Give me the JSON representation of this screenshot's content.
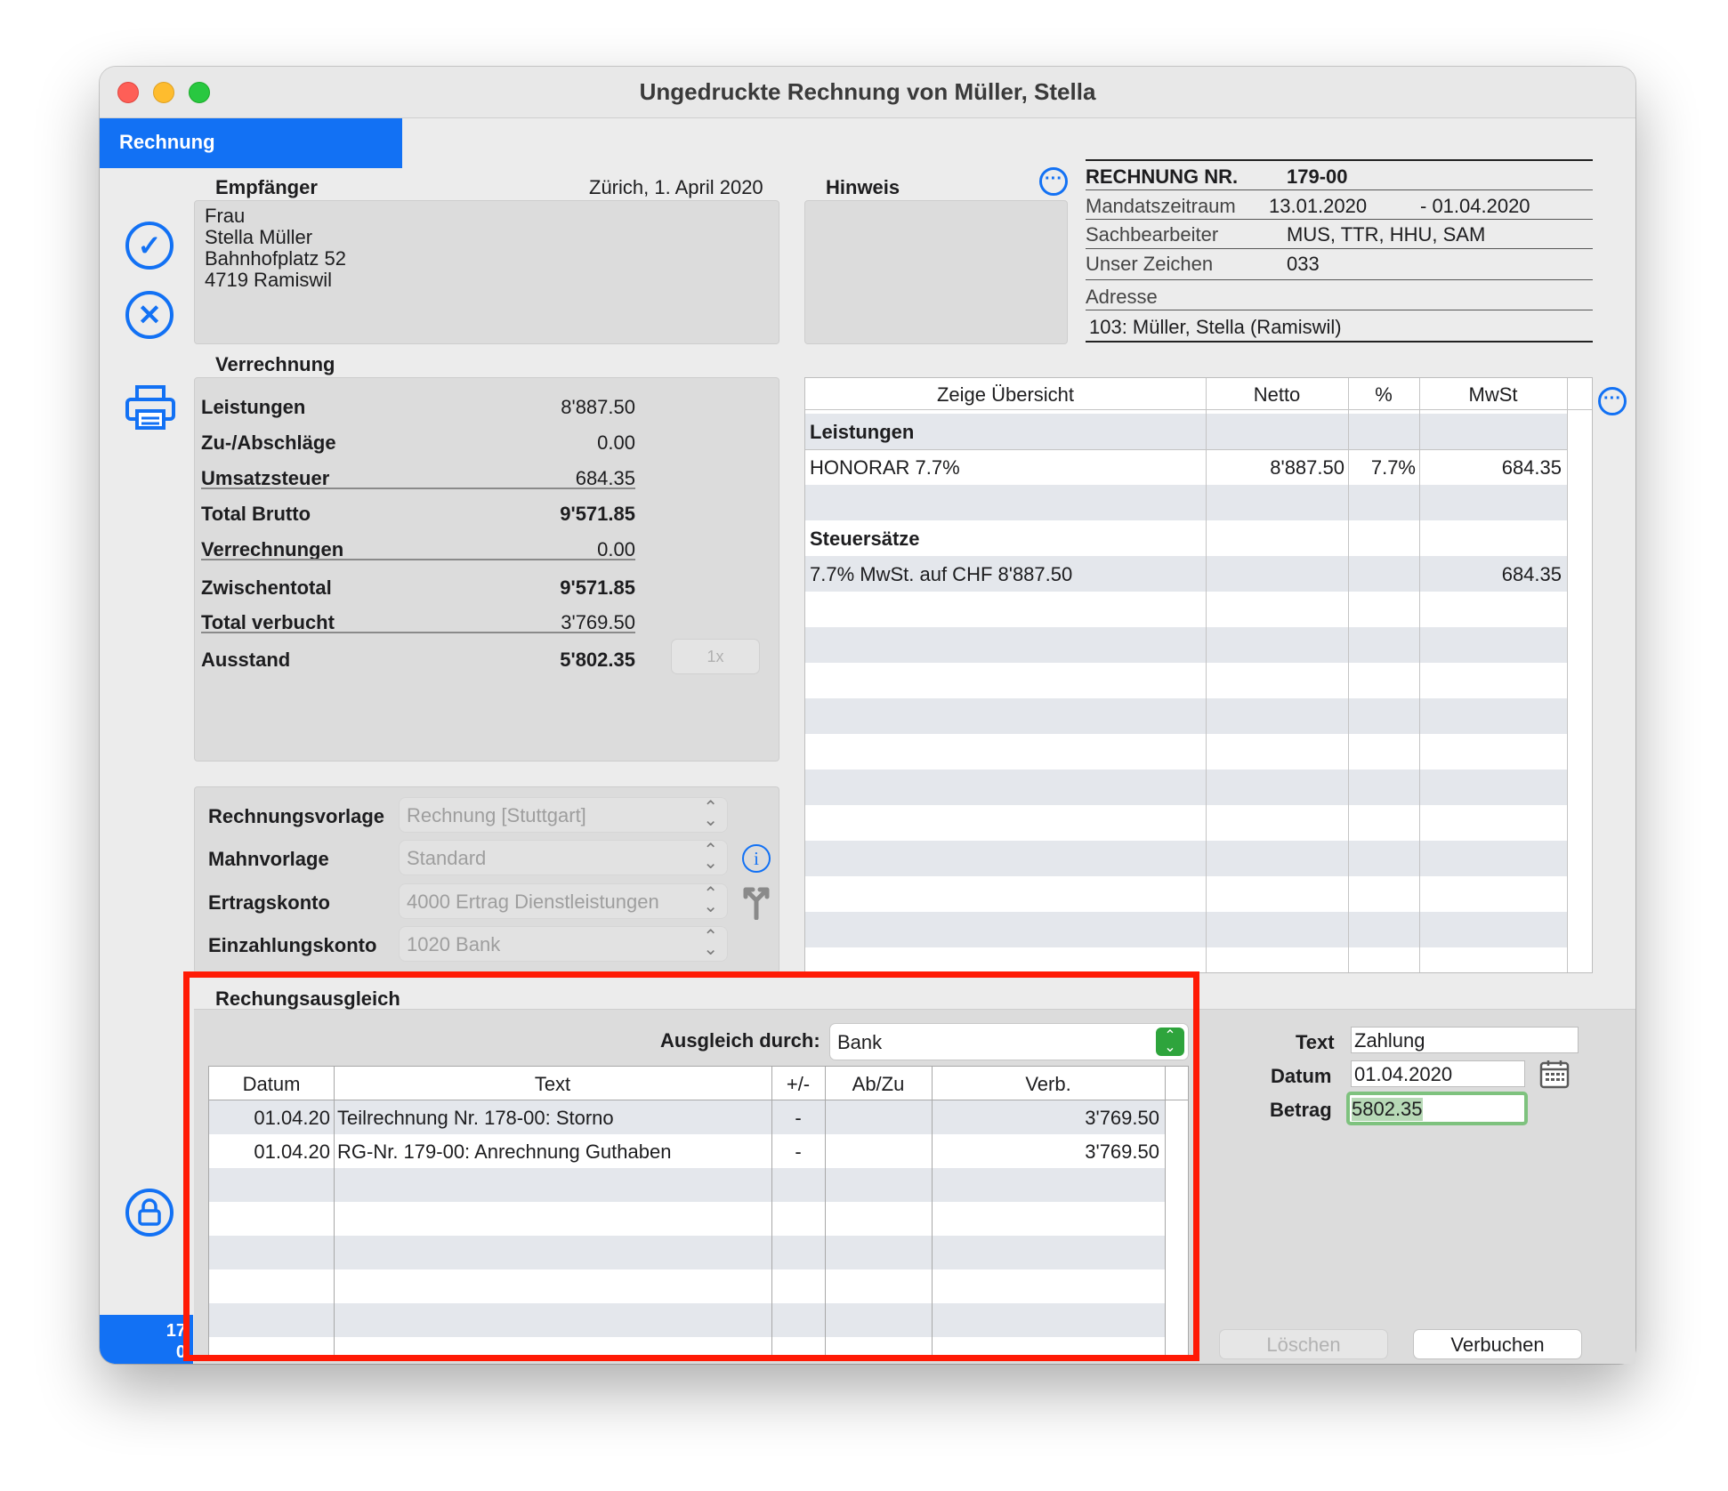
{
  "window": {
    "title": "Ungedruckte Rechnung von Müller, Stella"
  },
  "tab": {
    "label": "Rechnung"
  },
  "empfaenger": {
    "label": "Empfänger",
    "date_line": "Zürich, 1. April 2020",
    "address": [
      "Frau",
      "Stella Müller",
      "Bahnhofplatz 52",
      "4719 Ramiswil"
    ]
  },
  "hinweis": {
    "label": "Hinweis"
  },
  "invoice_info": {
    "nr_label": "RECHNUNG NR.",
    "nr_value": "179-00",
    "mandat_label": "Mandatszeitraum",
    "mandat_from": "13.01.2020",
    "mandat_to": "- 01.04.2020",
    "sach_label": "Sachbearbeiter",
    "sach_value": "MUS, TTR, HHU, SAM",
    "zeichen_label": "Unser Zeichen",
    "zeichen_value": "033",
    "adresse_label": "Adresse",
    "adresse_value": "103: Müller, Stella (Ramiswil)"
  },
  "verrechnung": {
    "label": "Verrechnung",
    "rows": [
      {
        "label": "Leistungen",
        "value": "8'887.50"
      },
      {
        "label": "Zu-/Abschläge",
        "value": "0.00"
      },
      {
        "label": "Umsatzsteuer",
        "value": "684.35"
      },
      {
        "label": "Total Brutto",
        "value": "9'571.85"
      },
      {
        "label": "Verrechnungen",
        "value": "0.00"
      },
      {
        "label": "Zwischentotal",
        "value": "9'571.85"
      },
      {
        "label": "Total verbucht",
        "value": "3'769.50"
      },
      {
        "label": "Ausstand",
        "value": "5'802.35"
      }
    ],
    "button_1x": "1x"
  },
  "settings": [
    {
      "label": "Rechnungsvorlage",
      "value": "Rechnung [Stuttgart]"
    },
    {
      "label": "Mahnvorlage",
      "value": "Standard"
    },
    {
      "label": "Ertragskonto",
      "value": "4000 Ertrag Dienstleistungen"
    },
    {
      "label": "Einzahlungskonto",
      "value": "1020 Bank"
    }
  ],
  "overview": {
    "headers": [
      "Zeige Übersicht",
      "Netto",
      "%",
      "MwSt"
    ],
    "section_leistungen": "Leistungen",
    "row_honorar": {
      "text": "HONORAR 7.7%",
      "netto": "8'887.50",
      "pct": "7.7%",
      "mwst": "684.35"
    },
    "section_steuer": "Steuersätze",
    "row_steuer": {
      "text": "7.7% MwSt. auf CHF 8'887.50",
      "mwst": "684.35"
    }
  },
  "ausgleich": {
    "label": "Rechungsausgleich",
    "durch_label": "Ausgleich durch:",
    "durch_value": "Bank",
    "headers": [
      "Datum",
      "Text",
      "+/-",
      "Ab/Zu",
      "Verb."
    ],
    "rows": [
      {
        "datum": "01.04.20",
        "text": "Teilrechnung Nr. 178-00: Storno",
        "pm": "-",
        "abzu": "",
        "verb": "3'769.50"
      },
      {
        "datum": "01.04.20",
        "text": "RG-Nr. 179-00: Anrechnung Guthaben",
        "pm": "-",
        "abzu": "",
        "verb": "3'769.50"
      }
    ]
  },
  "form": {
    "text_label": "Text",
    "text_value": "Zahlung",
    "datum_label": "Datum",
    "datum_value": "01.04.2020",
    "betrag_label": "Betrag",
    "betrag_value": "5802.35"
  },
  "buttons": {
    "loeschen": "Löschen",
    "verbuchen": "Verbuchen"
  },
  "statusbar": {
    "line1": "17",
    "line2": "0"
  },
  "colors": {
    "accent": "#1271f4",
    "highlight": "#ff1a05"
  }
}
